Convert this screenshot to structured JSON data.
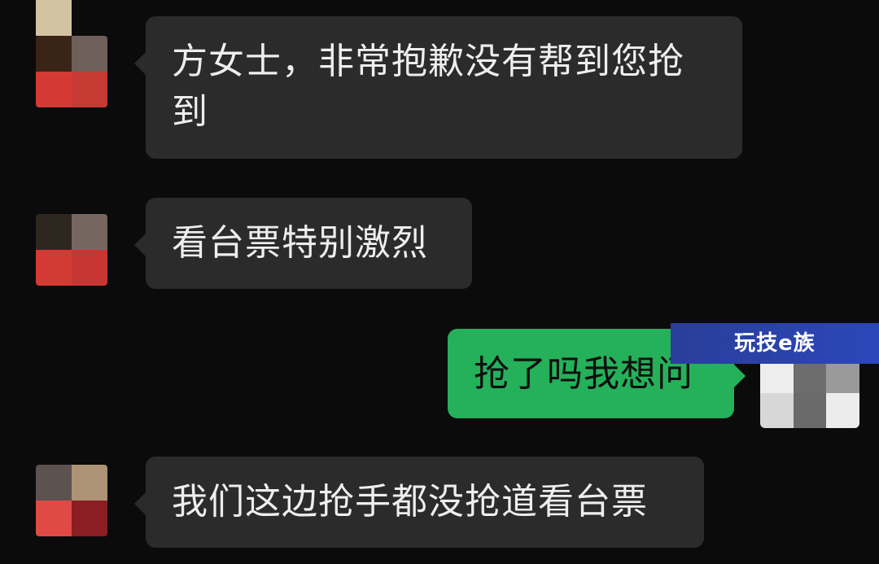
{
  "messages": [
    {
      "side": "left",
      "text": "方女士，非常抱歉没有帮到您抢到"
    },
    {
      "side": "left",
      "text": "看台票特别激烈"
    },
    {
      "side": "right",
      "text": "抢了吗我想问"
    },
    {
      "side": "left",
      "text": "我们这边抢手都没抢道看台票"
    }
  ],
  "watermark": {
    "text": "玩技e族"
  },
  "colors": {
    "background": "#0b0b0c",
    "incoming_bubble": "#2b2b2b",
    "outgoing_bubble": "#25b05a"
  }
}
